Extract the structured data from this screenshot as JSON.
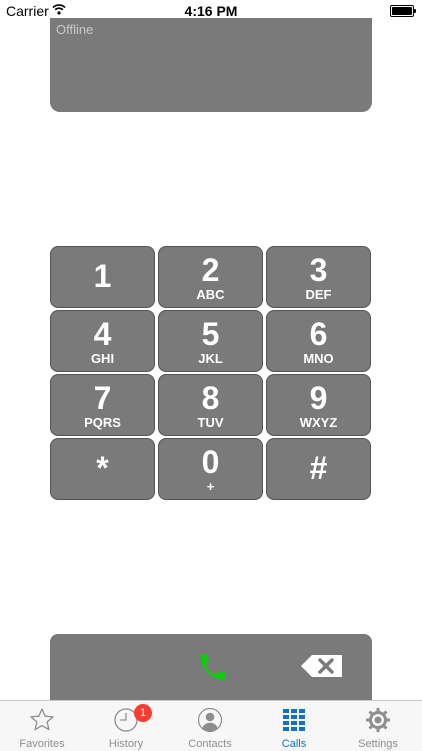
{
  "status_bar": {
    "carrier": "Carrier",
    "time": "4:16 PM"
  },
  "display": {
    "status": "Offline"
  },
  "keypad": {
    "keys": [
      {
        "digit": "1",
        "letters": ""
      },
      {
        "digit": "2",
        "letters": "ABC"
      },
      {
        "digit": "3",
        "letters": "DEF"
      },
      {
        "digit": "4",
        "letters": "GHI"
      },
      {
        "digit": "5",
        "letters": "JKL"
      },
      {
        "digit": "6",
        "letters": "MNO"
      },
      {
        "digit": "7",
        "letters": "PQRS"
      },
      {
        "digit": "8",
        "letters": "TUV"
      },
      {
        "digit": "9",
        "letters": "WXYZ"
      },
      {
        "digit": "*",
        "letters": ""
      },
      {
        "digit": "0",
        "letters": "+"
      },
      {
        "digit": "#",
        "letters": ""
      }
    ]
  },
  "actions": {
    "call_icon": "phone-icon",
    "delete_icon": "backspace-icon",
    "call_color": "#14c814"
  },
  "tabbar": {
    "active_color": "#0e72c8",
    "tabs": [
      {
        "label": "Favorites",
        "icon": "star-icon"
      },
      {
        "label": "History",
        "icon": "clock-icon",
        "badge": "1"
      },
      {
        "label": "Contacts",
        "icon": "contact-icon"
      },
      {
        "label": "Calls",
        "icon": "keypad-icon",
        "active": true
      },
      {
        "label": "Settings",
        "icon": "gear-icon"
      }
    ]
  }
}
